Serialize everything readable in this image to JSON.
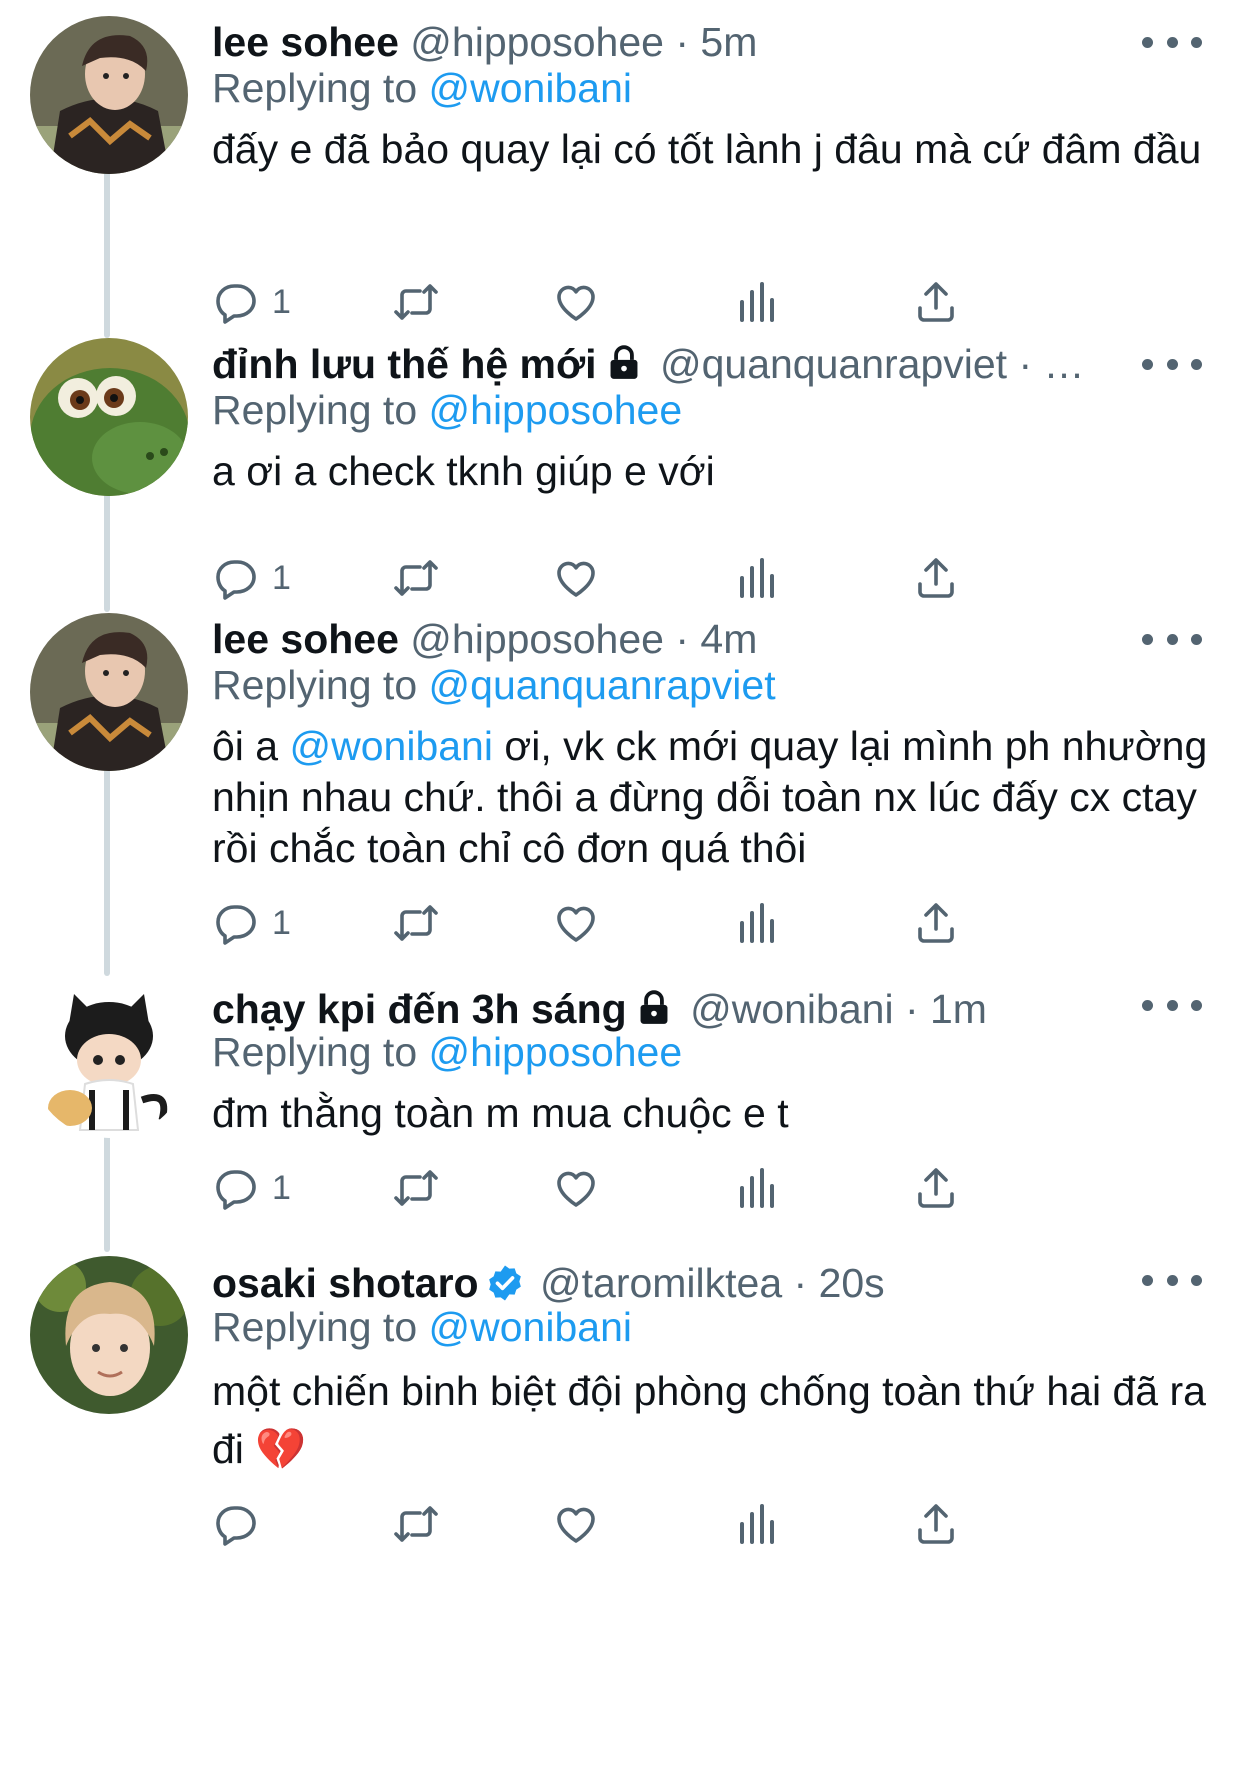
{
  "tweets": [
    {
      "name": "lee sohee",
      "handle": "@hipposohee",
      "time": "5m",
      "replying_prefix": "Replying to ",
      "replying_to": "@wonibani",
      "text": "đấy e đã bảo quay lại có tốt lành j đâu mà cứ đâm đầu",
      "reply_count": "1",
      "avatar_icon": "photo-boy-avatar"
    },
    {
      "name": "đỉnh lưu thế hệ mới",
      "handle": "@quanquanrapviet",
      "time": "…",
      "replying_prefix": "Replying to ",
      "replying_to": "@hipposohee",
      "text": "a ơi a check tknh giúp e với",
      "reply_count": "1",
      "avatar_icon": "green-dinosaur-avatar"
    },
    {
      "name": "lee sohee",
      "handle": "@hipposohee",
      "time": "4m",
      "replying_prefix": "Replying to ",
      "replying_to": "@quanquanrapviet",
      "text_before": "ôi a ",
      "text_mention": "@wonibani",
      "text_after": " ơi, vk ck mới quay lại mình ph nhường nhịn nhau chứ. thôi a đừng dỗi toàn nx lúc đấy cx ctay rồi chắc toàn chỉ cô đơn quá thôi",
      "reply_count": "1",
      "avatar_icon": "photo-boy-avatar"
    },
    {
      "name": "chạy kpi đến 3h sáng",
      "handle": "@wonibani",
      "time": "1m",
      "replying_prefix": "Replying to ",
      "replying_to": "@hipposohee",
      "text": "đm thằng toàn m mua chuộc e t",
      "reply_count": "1",
      "avatar_icon": "cat-doll-avatar"
    },
    {
      "name": "osaki shotaro",
      "handle": "@taromilktea",
      "time": "20s",
      "replying_prefix": "Replying to ",
      "replying_to": "@wonibani",
      "text": "một chiến binh biệt đội phòng chống toàn thứ hai đã ra đi",
      "emoji": "💔",
      "reply_count": "",
      "avatar_icon": "photo-blond-avatar"
    }
  ],
  "sep": " · ",
  "colors": {
    "accent": "#1d9bf0",
    "secondary": "#536471",
    "text": "#0f1419",
    "thread_line": "#cfd9de"
  },
  "icons": [
    "reply-icon",
    "retweet-icon",
    "like-icon",
    "views-icon",
    "share-icon",
    "lock-icon",
    "verified-icon",
    "more-icon"
  ]
}
